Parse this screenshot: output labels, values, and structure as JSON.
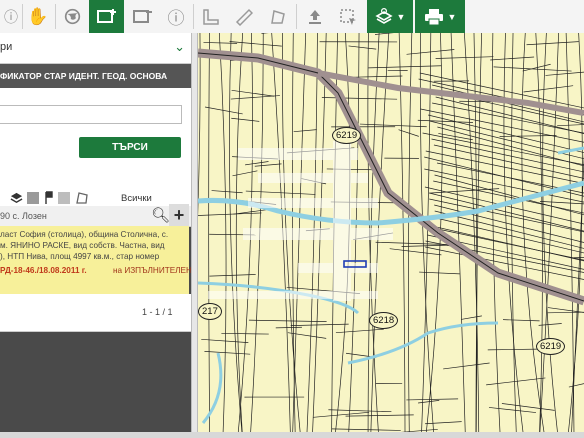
{
  "toolbar": {
    "buttons": [
      {
        "name": "info-i-icon"
      },
      {
        "name": "hand-icon"
      },
      {
        "name": "globe-icon"
      },
      {
        "name": "add-layer-icon"
      },
      {
        "name": "layer-minus-icon"
      },
      {
        "name": "info-icon"
      },
      {
        "name": "measure-icon"
      },
      {
        "name": "ruler-icon"
      },
      {
        "name": "polygon-icon"
      },
      {
        "name": "upload-icon"
      },
      {
        "name": "select-icon"
      },
      {
        "name": "layers-icon"
      },
      {
        "name": "print-icon"
      }
    ]
  },
  "panel": {
    "dropdown_text": "ри",
    "tabs": [
      "ФИКАТОР",
      "СТАР ИДЕНТ.",
      "ГЕОД. ОСНОВА"
    ],
    "search_value": "",
    "search_button": "ТЪРСИ",
    "layer_all_label": "Всички",
    "result_header": "90 с. Лозен",
    "result_lines": [
      "ласт София (столица), община Столична, с.",
      "м. ЯНИНО РАСКЕ, вид собств. Частна, вид",
      "), НТП Нива, площ 4997 кв.м., стар номер"
    ],
    "result_order": "РД-18-46./18.08.2011 г.",
    "result_order_suffix": "на ИЗПЪЛНИТЕЛЕН",
    "pager": "1 - 1 / 1"
  },
  "map": {
    "labels": [
      "6219",
      "6218",
      "6219",
      "217"
    ],
    "colors": {
      "background": "#f8f5c6",
      "river": "#8ecfe2",
      "road": "#a09090",
      "highlight": "#1e3db5"
    }
  }
}
